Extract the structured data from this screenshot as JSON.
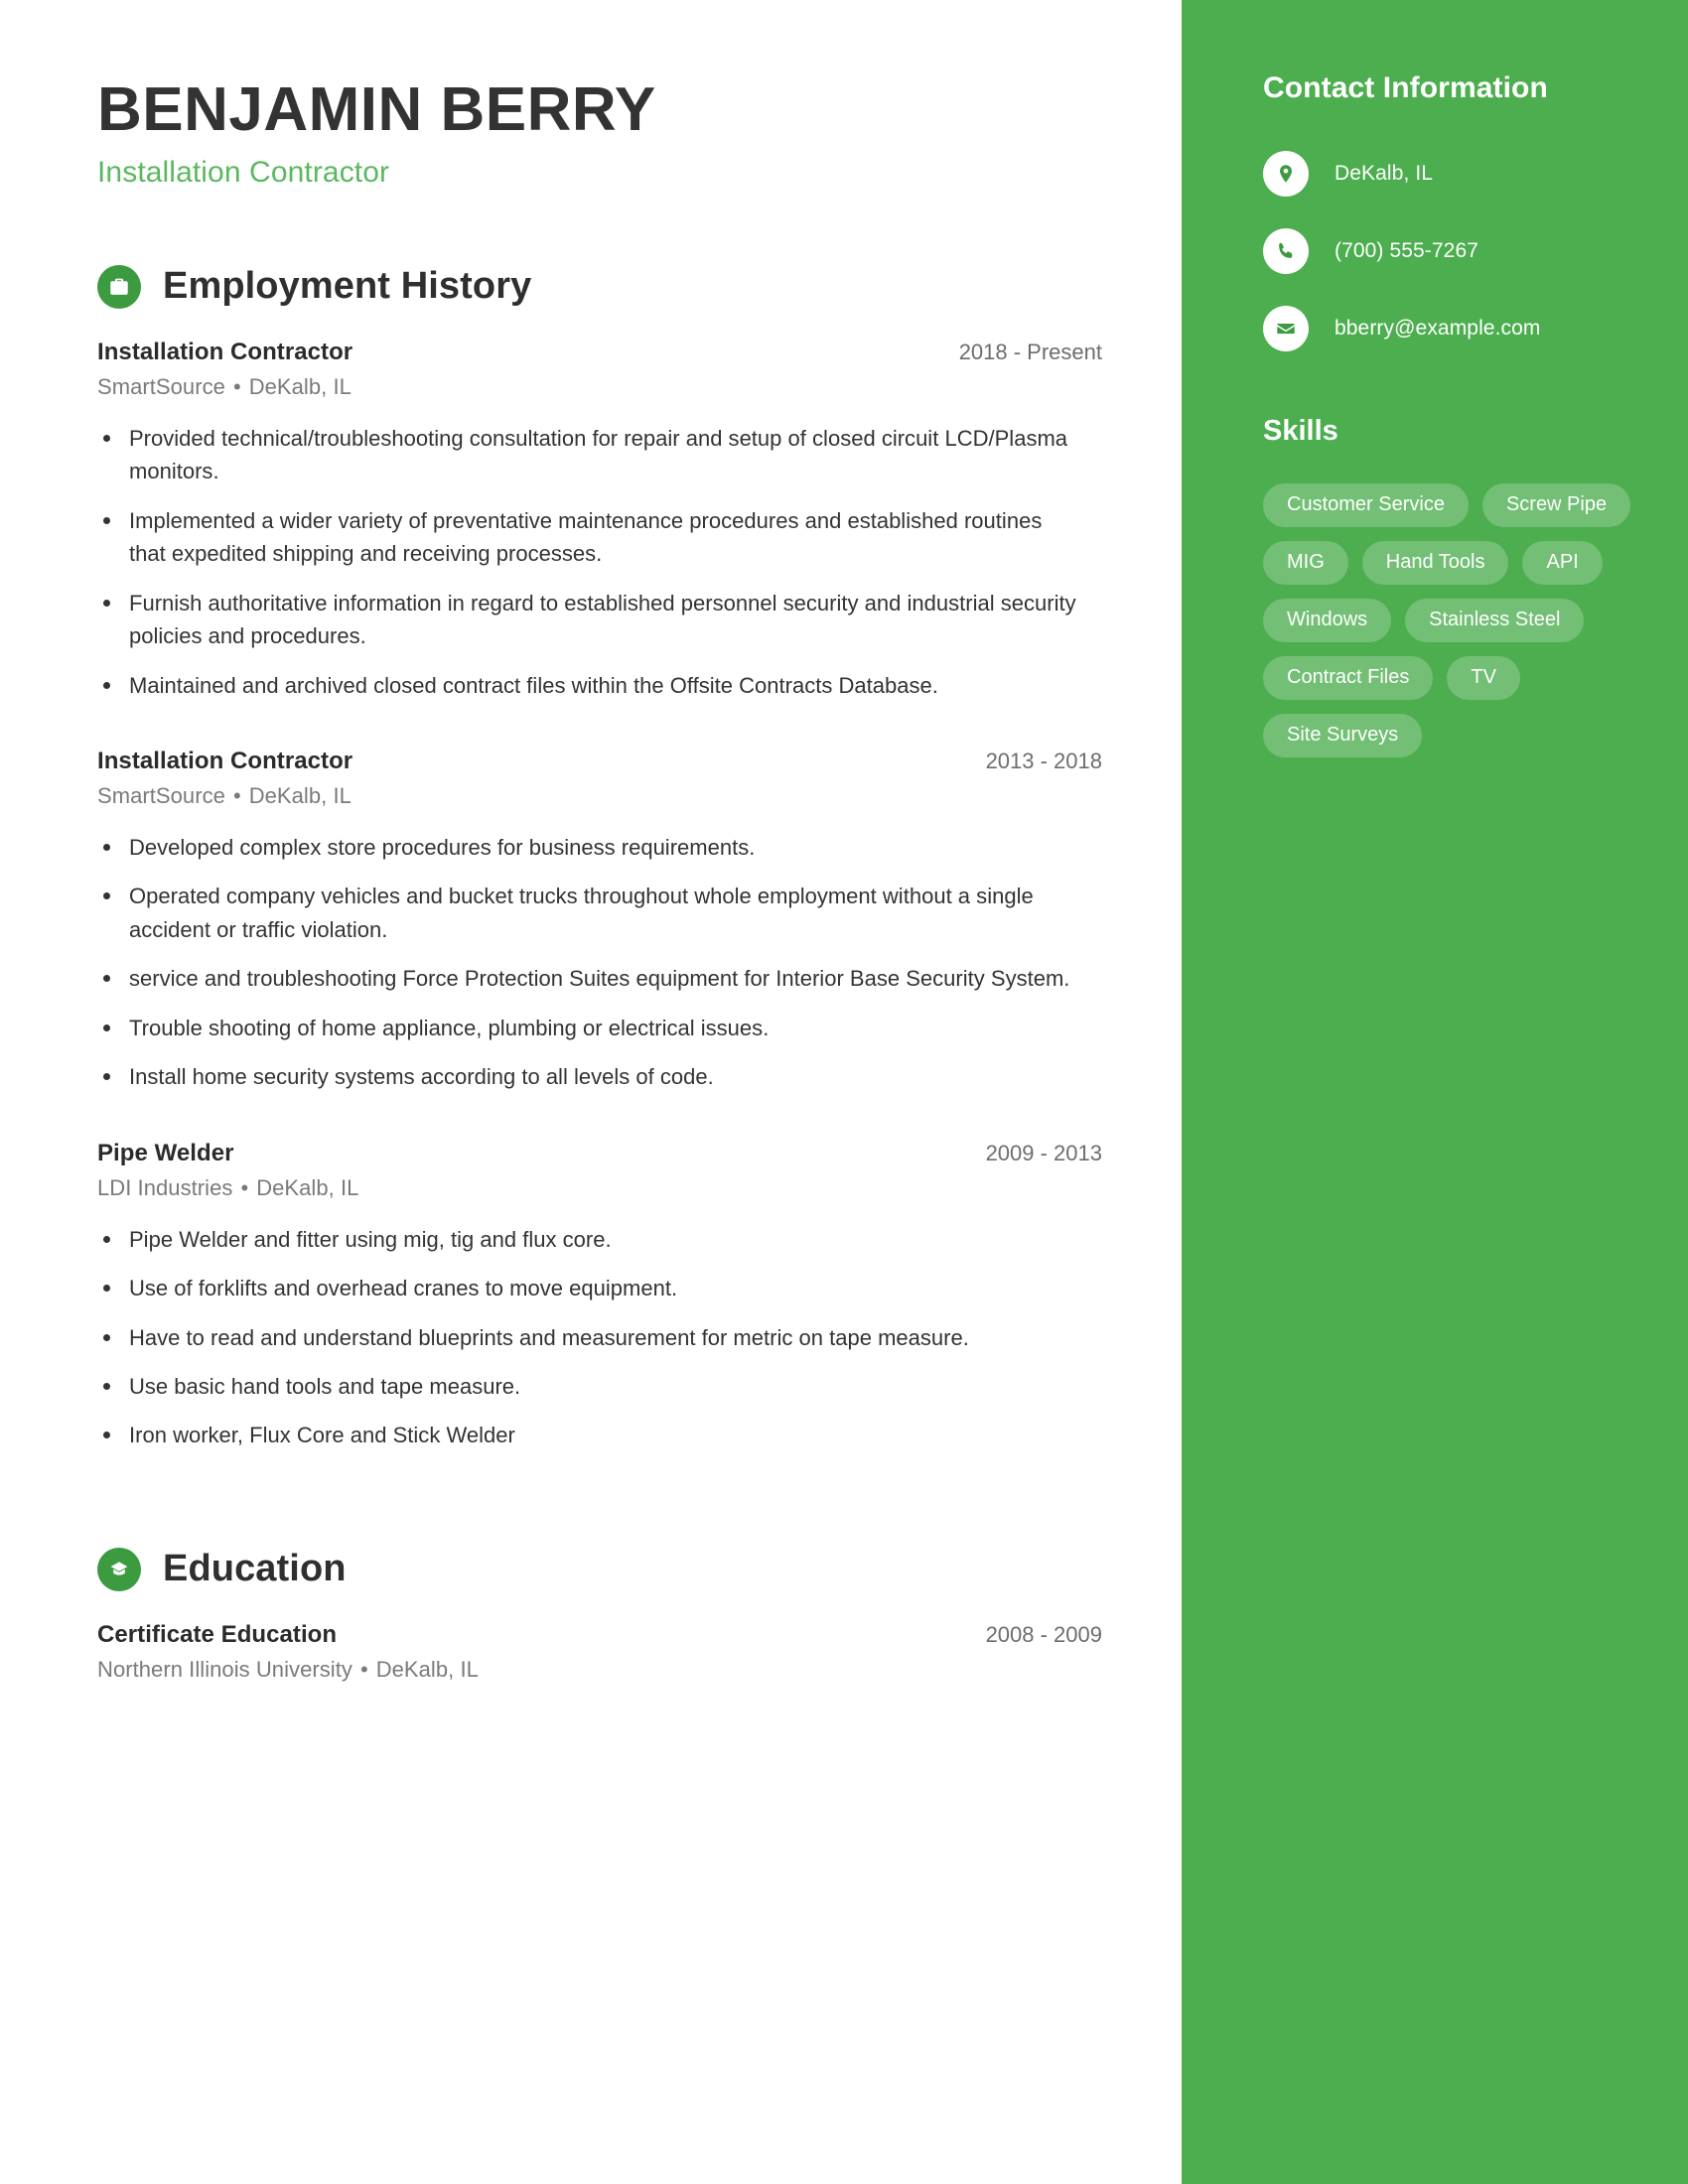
{
  "header": {
    "name": "BENJAMIN BERRY",
    "title": "Installation Contractor"
  },
  "sections": {
    "employment": {
      "title": "Employment History",
      "icon": "briefcase-icon"
    },
    "education": {
      "title": "Education",
      "icon": "graduation-cap-icon"
    }
  },
  "employment": [
    {
      "title": "Installation Contractor",
      "dates": "2018 - Present",
      "company": "SmartSource",
      "location": "DeKalb, IL",
      "bullets": [
        "Provided technical/troubleshooting consultation for repair and setup of closed circuit LCD/Plasma monitors.",
        "Implemented a wider variety of preventative maintenance procedures and established routines that expedited shipping and receiving processes.",
        "Furnish authoritative information in regard to established personnel security and industrial security policies and procedures.",
        "Maintained and archived closed contract files within the Offsite Contracts Database."
      ]
    },
    {
      "title": "Installation Contractor",
      "dates": "2013 - 2018",
      "company": "SmartSource",
      "location": "DeKalb, IL",
      "bullets": [
        "Developed complex store procedures for business requirements.",
        "Operated company vehicles and bucket trucks throughout whole employment without a single accident or traffic violation.",
        "service and troubleshooting Force Protection Suites equipment for Interior Base Security System.",
        "Trouble shooting of home appliance, plumbing or electrical issues.",
        "Install home security systems according to all levels of code."
      ]
    },
    {
      "title": "Pipe Welder",
      "dates": "2009 - 2013",
      "company": "LDI Industries",
      "location": "DeKalb, IL",
      "bullets": [
        "Pipe Welder and fitter using mig, tig and flux core.",
        "Use of forklifts and overhead cranes to move equipment.",
        "Have to read and understand blueprints and measurement for metric on tape measure.",
        "Use basic hand tools and tape measure.",
        "Iron worker, Flux Core and Stick Welder"
      ]
    }
  ],
  "education": [
    {
      "title": "Certificate Education",
      "dates": "2008 - 2009",
      "school": "Northern Illinois University",
      "location": "DeKalb, IL"
    }
  ],
  "sidebar": {
    "contact_heading": "Contact Information",
    "contacts": [
      {
        "icon": "location-pin-icon",
        "value": "DeKalb, IL"
      },
      {
        "icon": "phone-icon",
        "value": "(700) 555-7267"
      },
      {
        "icon": "envelope-icon",
        "value": "bberry@example.com"
      }
    ],
    "skills_heading": "Skills",
    "skills": [
      "Customer Service",
      "Screw Pipe",
      "MIG",
      "Hand Tools",
      "API",
      "Windows",
      "Stainless Steel",
      "Contract Files",
      "TV",
      "Site Surveys"
    ]
  },
  "colors": {
    "sidebar_green": "#4CAE4F",
    "accent_green": "#5BB85F",
    "icon_circle_green": "#3C9B40",
    "heading_dark": "#333333",
    "muted_gray": "#7A7A7A"
  }
}
